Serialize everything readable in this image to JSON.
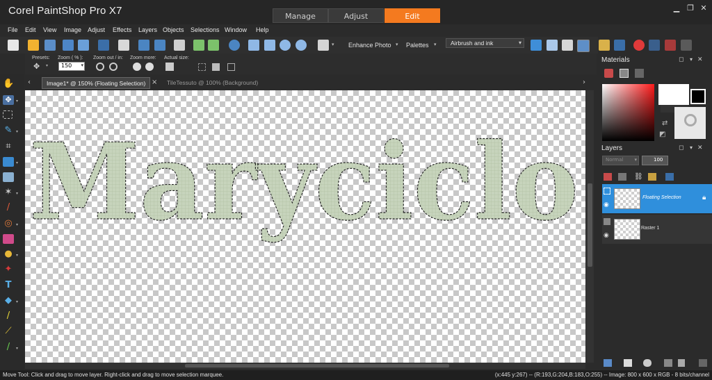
{
  "app": {
    "title": "Corel PaintShop Pro X7"
  },
  "modes": [
    {
      "label": "Manage"
    },
    {
      "label": "Adjust"
    },
    {
      "label": "Edit"
    }
  ],
  "window_controls": {
    "minimize": "▁",
    "restore": "❐",
    "close": "✕"
  },
  "menu": [
    "File",
    "Edit",
    "View",
    "Image",
    "Adjust",
    "Effects",
    "Layers",
    "Objects",
    "Selections",
    "Window",
    "Help"
  ],
  "toolbar": {
    "enhance_photo": "Enhance Photo",
    "palettes": "Palettes",
    "workspace": "Airbrush and ink"
  },
  "tool_options": {
    "presets_label": "Presets:",
    "zoom_label": "Zoom ( % ):",
    "zoom_value": "150",
    "zoom_out_label": "Zoom out / in:",
    "zoom_more_label": "Zoom more:",
    "actual_size_label": "Actual size:"
  },
  "doc_tabs": [
    {
      "label": "Image1* @ 150% (Floating Selection)",
      "active": true
    },
    {
      "label": "TileTessuto @ 100% (Background)",
      "active": false
    }
  ],
  "canvas": {
    "text": "Maryciclo",
    "text_color": "#c9d6bf"
  },
  "materials": {
    "title": "Materials"
  },
  "layers": {
    "title": "Layers",
    "blend_mode": "Normal",
    "opacity": "100",
    "items": [
      {
        "name": "Floating Selection",
        "selected": true
      },
      {
        "name": "Raster 1",
        "selected": false
      }
    ]
  },
  "status": {
    "left": "Move Tool: Click and drag to move layer. Right-click and drag to move selection marquee.",
    "right": "(x:445 y:267) -- (R:193,G:204,B:183,O:255) -- Image:  800 x 600 x RGB - 8 bits/channel"
  },
  "colors": {
    "accent": "#f47a1f",
    "selection": "#2f8fdc"
  }
}
